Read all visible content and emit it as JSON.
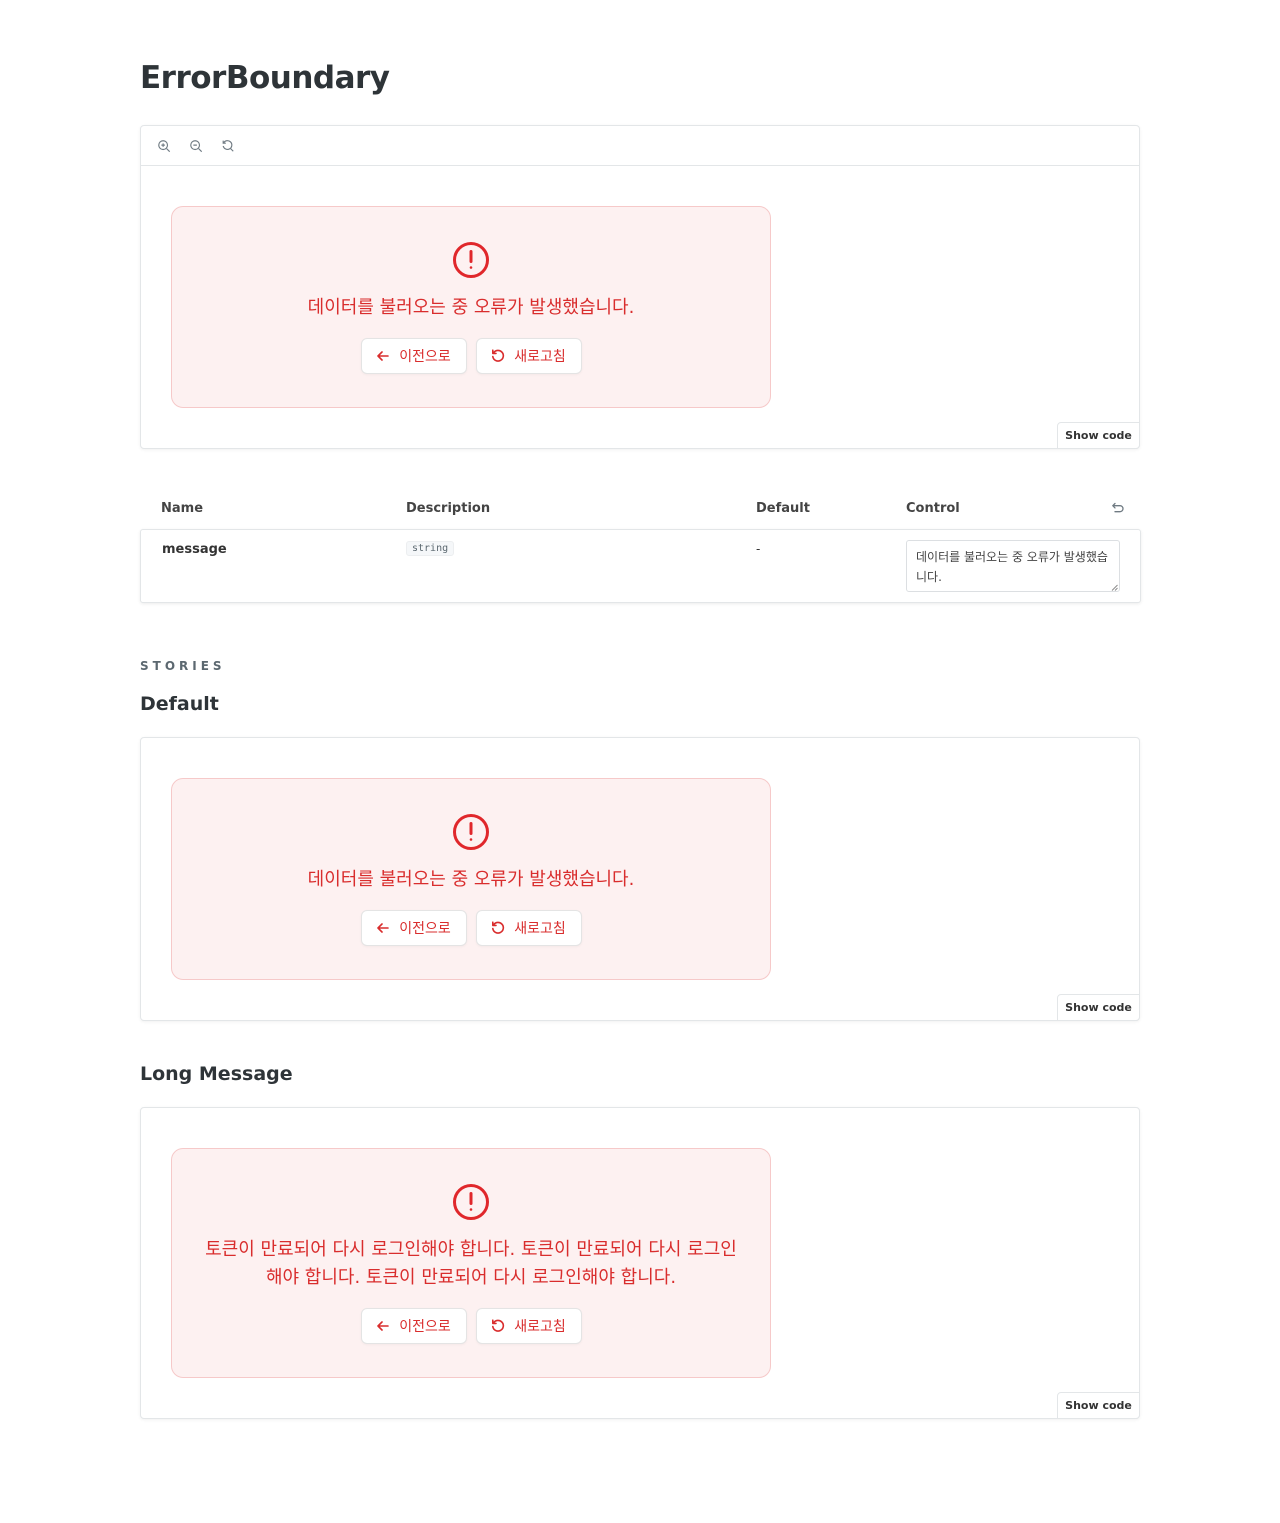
{
  "page": {
    "title": "ErrorBoundary"
  },
  "primary": {
    "toolbar": [
      "zoom-in-icon",
      "zoom-out-icon",
      "reset-zoom-icon"
    ],
    "message": "데이터를 불러오는 중 오류가 발생했습니다.",
    "show_code": "Show code"
  },
  "buttons": {
    "prev": "이전으로",
    "refresh": "새로고침"
  },
  "args_table": {
    "headers": {
      "name": "Name",
      "description": "Description",
      "default": "Default",
      "control": "Control"
    },
    "rows": [
      {
        "name": "message",
        "type": "string",
        "default": "-",
        "control_value": "데이터를 불러오는 중 오류가 발생했습니다."
      }
    ]
  },
  "stories": {
    "label": "STORIES",
    "items": [
      {
        "title": "Default",
        "message": "데이터를 불러오는 중 오류가 발생했습니다.",
        "show_code": "Show code"
      },
      {
        "title": "Long Message",
        "message": "토큰이 만료되어 다시 로그인해야 합니다. 토큰이 만료되어 다시 로그인해야 합니다. 토큰이 만료되어 다시 로그인해야 합니다.",
        "show_code": "Show code"
      }
    ]
  },
  "colors": {
    "error": "#d92d2d",
    "error_bg": "#fdf1f1",
    "error_border": "#f6c9c9",
    "border": "#e3e6e8"
  }
}
